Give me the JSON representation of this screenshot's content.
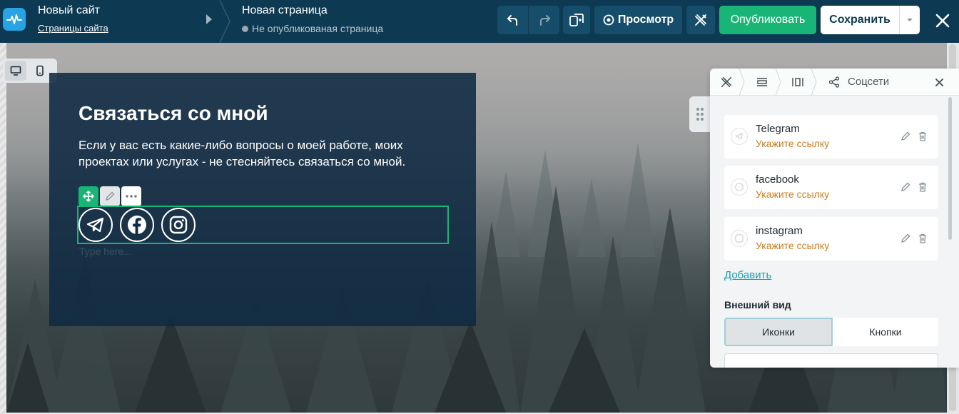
{
  "header": {
    "site_title": "Новый сайт",
    "site_pages_link": "Страницы сайта",
    "page_title": "Новая страница",
    "page_status": "Не опубликованая страница",
    "preview_label": "Просмотр",
    "publish_label": "Опубликовать",
    "save_label": "Сохранить"
  },
  "canvas": {
    "section_title": "Связаться со мной",
    "section_text": "Если у вас есть какие-либо вопросы о моей работе, моих проектах или услугах - не стесняйтесь связаться со мной.",
    "placeholder": "Type here..."
  },
  "panel": {
    "title": "Соцсети",
    "networks": [
      {
        "name": "Telegram",
        "link_hint": "Укажите ссылку"
      },
      {
        "name": "facebook",
        "link_hint": "Укажите ссылку"
      },
      {
        "name": "instagram",
        "link_hint": "Укажите ссылку"
      }
    ],
    "add_label": "Добавить",
    "appearance_label": "Внешний вид",
    "style_options": [
      "Иконки",
      "Кнопки"
    ],
    "selected_style": "Иконки"
  },
  "colors": {
    "topbar": "#0d3a52",
    "accent_green": "#19b576",
    "link_blue": "#1a9ab8",
    "hint_orange": "#c97b1e"
  },
  "icons": [
    "logo-icon",
    "undo-icon",
    "redo-icon",
    "pages-icon",
    "eye-icon",
    "design-icon",
    "chevron-down-icon",
    "close-icon",
    "desktop-icon",
    "mobile-icon",
    "move-icon",
    "pencil-icon",
    "more-icon",
    "telegram-icon",
    "facebook-icon",
    "instagram-icon",
    "drag-icon",
    "share-icon",
    "trash-icon"
  ]
}
